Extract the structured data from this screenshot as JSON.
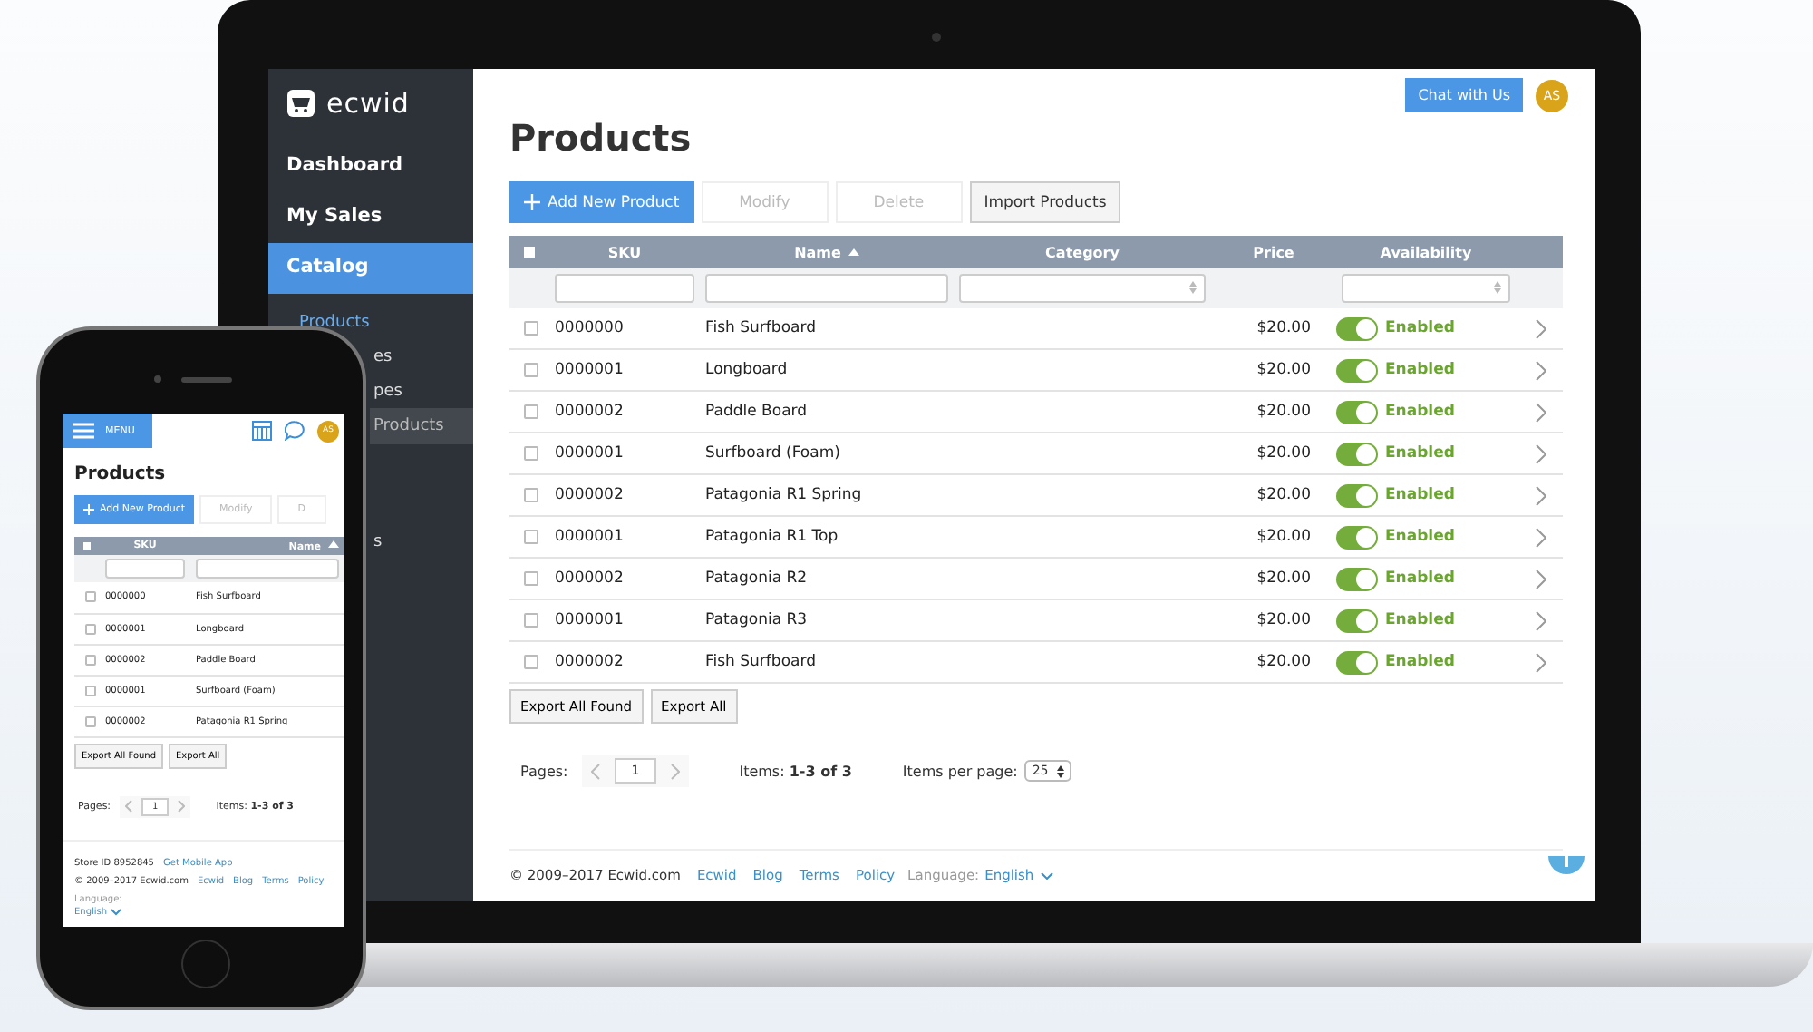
{
  "laptop": {
    "sidebar": {
      "logo": "ecwid",
      "items": [
        {
          "label": "Dashboard",
          "selected": false
        },
        {
          "label": "My Sales",
          "selected": false
        },
        {
          "label": "Catalog",
          "selected": true
        }
      ],
      "sub_items": [
        {
          "label": "Products",
          "selected": true,
          "hovered": false
        },
        {
          "label": "es",
          "selected": false,
          "hovered": false
        },
        {
          "label": "pes",
          "selected": false,
          "hovered": false
        },
        {
          "label": "Products",
          "selected": false,
          "hovered": true
        }
      ],
      "lower_items": [
        {
          "label": "s"
        }
      ]
    },
    "header": {
      "chat_button": "Chat with Us",
      "avatar": "AS"
    },
    "title": "Products",
    "toolbar": [
      {
        "label": "Add New Product",
        "kind": "primary",
        "disabled": false
      },
      {
        "label": "Modify",
        "kind": "plain",
        "disabled": true
      },
      {
        "label": "Delete",
        "kind": "plain",
        "disabled": true
      },
      {
        "label": "Import Products",
        "kind": "plain",
        "disabled": false
      }
    ],
    "table": {
      "columns": [
        {
          "label": "SKU",
          "sorted": false
        },
        {
          "label": "Name",
          "sorted": true
        },
        {
          "label": "Category",
          "sorted": false
        },
        {
          "label": "Price",
          "sorted": false
        },
        {
          "label": "Availability",
          "sorted": false
        }
      ],
      "select_all_checked": false,
      "rows": [
        {
          "checked": false,
          "sku": "0000000",
          "name": "Fish Surfboard",
          "price": "$20.00",
          "enabled": true,
          "status": "Enabled"
        },
        {
          "checked": false,
          "sku": "0000001",
          "name": "Longboard",
          "price": "$20.00",
          "enabled": true,
          "status": "Enabled"
        },
        {
          "checked": false,
          "sku": "0000002",
          "name": "Paddle Board",
          "price": "$20.00",
          "enabled": true,
          "status": "Enabled"
        },
        {
          "checked": false,
          "sku": "0000001",
          "name": "Surfboard (Foam)",
          "price": "$20.00",
          "enabled": true,
          "status": "Enabled"
        },
        {
          "checked": false,
          "sku": "0000002",
          "name": "Patagonia R1 Spring",
          "price": "$20.00",
          "enabled": true,
          "status": "Enabled"
        },
        {
          "checked": false,
          "sku": "0000001",
          "name": "Patagonia R1 Top",
          "price": "$20.00",
          "enabled": true,
          "status": "Enabled"
        },
        {
          "checked": false,
          "sku": "0000002",
          "name": "Patagonia R2",
          "price": "$20.00",
          "enabled": true,
          "status": "Enabled"
        },
        {
          "checked": false,
          "sku": "0000001",
          "name": "Patagonia R3",
          "price": "$20.00",
          "enabled": true,
          "status": "Enabled"
        },
        {
          "checked": false,
          "sku": "0000002",
          "name": "Fish Surfboard",
          "price": "$20.00",
          "enabled": true,
          "status": "Enabled"
        }
      ]
    },
    "export_buttons": [
      "Export All Found",
      "Export All"
    ],
    "pagination": {
      "label": "Pages:",
      "page": "1",
      "items": "Items: **1-3 of 3**",
      "per_page_label": "Items per page:",
      "per_page": "25"
    },
    "footer": {
      "copyright": "© 2009–2017 Ecwid.com",
      "links": [
        "Ecwid",
        "Blog",
        "Terms",
        "Policy"
      ],
      "language_label": "Language:",
      "language": "English"
    }
  },
  "phone": {
    "menu_label": "MENU",
    "avatar": "AS",
    "title": "Products",
    "toolbar": [
      {
        "label": "Add New Product",
        "kind": "primary"
      },
      {
        "label": "Modify",
        "kind": "plain"
      },
      {
        "label": "D",
        "kind": "plain"
      }
    ],
    "select_all_checked": false,
    "columns": [
      {
        "label": "SKU",
        "sorted": false
      },
      {
        "label": "Name",
        "sorted": true
      }
    ],
    "rows": [
      {
        "checked": false,
        "sku": "0000000",
        "name": "Fish Surfboard"
      },
      {
        "checked": false,
        "sku": "0000001",
        "name": "Longboard"
      },
      {
        "checked": false,
        "sku": "0000002",
        "name": "Paddle Board"
      },
      {
        "checked": false,
        "sku": "0000001",
        "name": "Surfboard (Foam)"
      },
      {
        "checked": false,
        "sku": "0000002",
        "name": "Patagonia R1 Spring"
      }
    ],
    "export_buttons": [
      "Export All Found",
      "Export All"
    ],
    "pagination": {
      "label": "Pages:",
      "page": "1",
      "items": "Items: **1-3 of 3**"
    },
    "footer": {
      "store_id": "Store ID 8952845",
      "mobile_link": "Get Mobile App",
      "copyright": "© 2009–2017 Ecwid.com",
      "links": [
        "Ecwid",
        "Blog",
        "Terms",
        "Policy"
      ],
      "language_label": "Language:",
      "language": "English"
    }
  }
}
